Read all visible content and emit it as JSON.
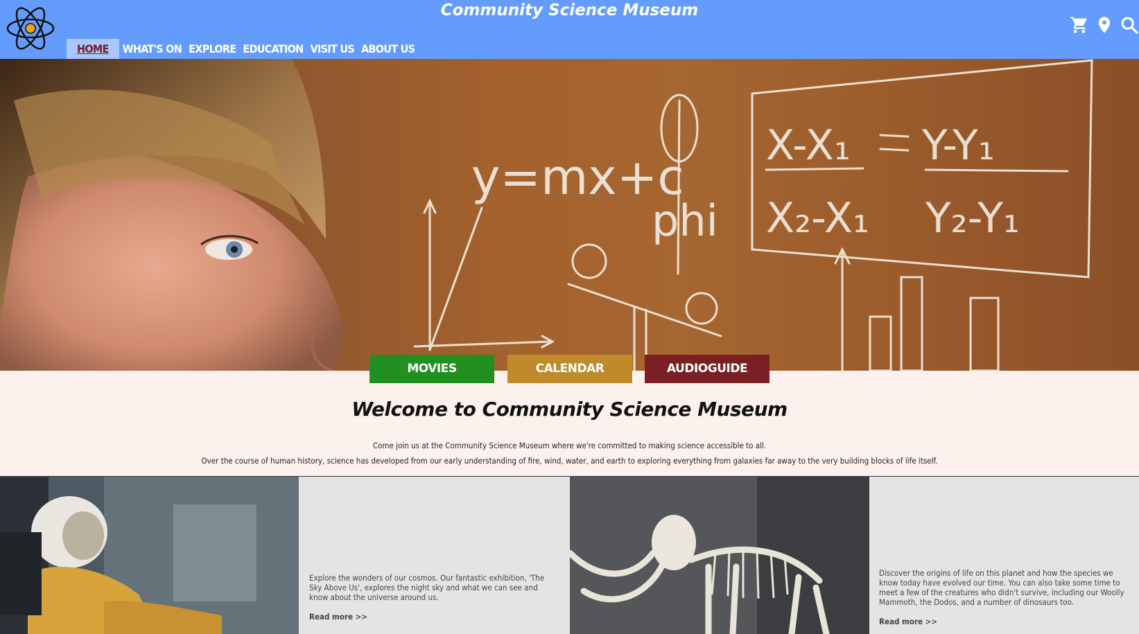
{
  "header": {
    "title": "Community Science Museum",
    "nav": [
      "HOME",
      "WHAT'S ON",
      "EXPLORE",
      "EDUCATION",
      "VISIT US",
      "ABOUT US"
    ],
    "icons": [
      "cart-icon",
      "location-pin-icon",
      "search-icon"
    ]
  },
  "hero": {
    "chalk_equation": "y=mx+c",
    "chalk_phi": "phi"
  },
  "quick_links": {
    "movies": "MOVIES",
    "calendar": "CALENDAR",
    "audioguide": "AUDIOGUIDE"
  },
  "welcome": {
    "title": "Welcome to Community Science Museum",
    "line1": "Come join us at the Community Science Museum where we're committed to making science accessible to all.",
    "line2": "Over the course of human history, science has developed from our early understanding of fire, wind, water, and earth to exploring everything from galaxies far away to the very building blocks of life itself."
  },
  "features": [
    {
      "text": "Explore the wonders of our cosmos. Our fantastic exhibition, 'The Sky Above Us', explores the night sky and what we can see and know about the universe around us.",
      "link": "Read more >>"
    },
    {
      "text": "Discover the origins of life on this planet and how the species we know today have evolved our time. You can also take some time to meet a few of the creatures who didn't survive, including our Woolly Mammoth, the Dodos, and a number of dinosaurs too.",
      "link": "Read more >>"
    }
  ],
  "colors": {
    "header": "#649cfd",
    "movies": "#229021",
    "calendar": "#bf8b2a",
    "audioguide": "#7a1f24",
    "active_nav": "#7a1d22"
  }
}
